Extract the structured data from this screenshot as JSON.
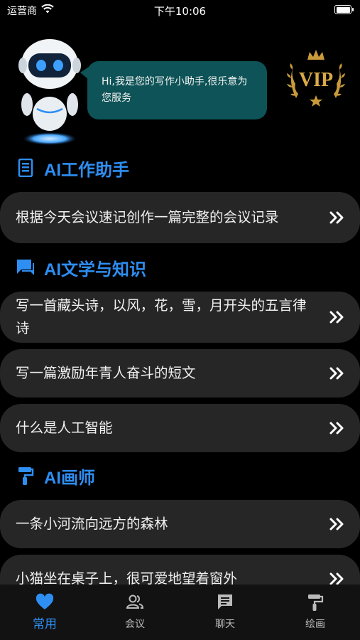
{
  "status_bar": {
    "carrier": "运营商",
    "time": "下午10:06"
  },
  "header": {
    "greeting": "Hi,我是您的写作小助手,很乐意为您服务",
    "vip_badge_text": "VIP"
  },
  "sections": [
    {
      "title": "AI工作助手",
      "icon": "phone-doc-icon",
      "items": [
        "根据今天会议速记创作一篇完整的会议记录"
      ]
    },
    {
      "title": "AI文学与知识",
      "icon": "chat-icon",
      "items": [
        "写一首藏头诗，以风，花，雪，月开头的五言律诗",
        "写一篇激励年青人奋斗的短文",
        "什么是人工智能"
      ]
    },
    {
      "title": "AI画师",
      "icon": "paint-roller-icon",
      "items": [
        "一条小河流向远方的森林",
        "小猫坐在桌子上，很可爱地望着窗外"
      ]
    }
  ],
  "tabbar": {
    "tabs": [
      {
        "label": "常用",
        "icon": "heart-icon",
        "active": true
      },
      {
        "label": "会议",
        "icon": "people-icon",
        "active": false
      },
      {
        "label": "聊天",
        "icon": "chat-icon",
        "active": false
      },
      {
        "label": "绘画",
        "icon": "paint-roller-icon",
        "active": false
      }
    ]
  },
  "colors": {
    "accent": "#2e8ef2",
    "card_bg": "#262626",
    "bubble_bg": "#0d5357",
    "vip_gold": "#c99a3b"
  }
}
